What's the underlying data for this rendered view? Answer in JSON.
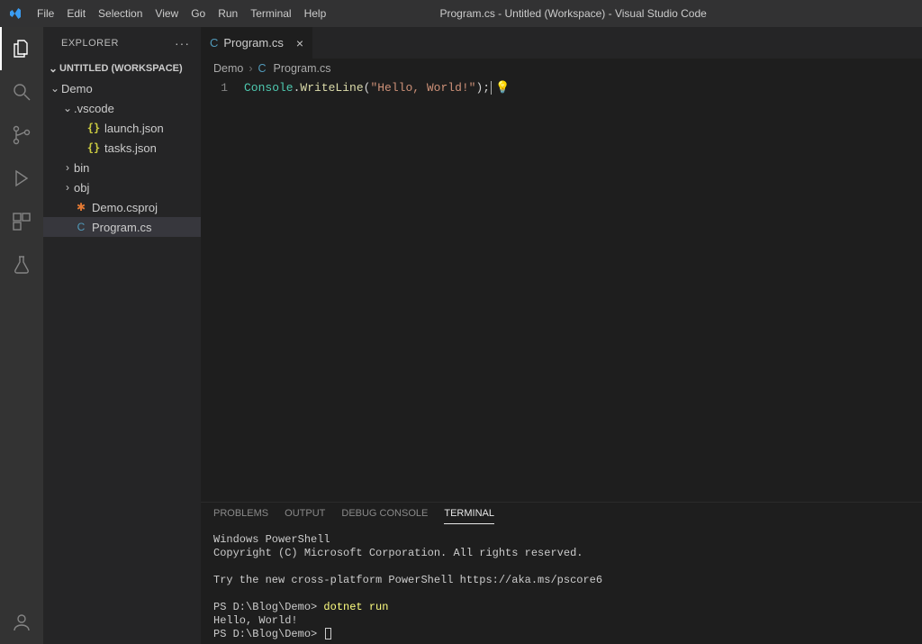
{
  "window": {
    "title": "Program.cs - Untitled (Workspace) - Visual Studio Code"
  },
  "menubar": [
    "File",
    "Edit",
    "Selection",
    "View",
    "Go",
    "Run",
    "Terminal",
    "Help"
  ],
  "sidebar": {
    "title": "EXPLORER",
    "section": "UNTITLED (WORKSPACE)",
    "tree": {
      "demo": "Demo",
      "vscode": ".vscode",
      "launch": "launch.json",
      "tasks": "tasks.json",
      "bin": "bin",
      "obj": "obj",
      "csproj": "Demo.csproj",
      "program": "Program.cs"
    }
  },
  "tab": {
    "label": "Program.cs"
  },
  "breadcrumbs": {
    "a": "Demo",
    "b": "Program.cs"
  },
  "editor": {
    "lineNumber": "1",
    "tok_type": "Console",
    "tok_dot": ".",
    "tok_member": "WriteLine",
    "tok_open": "(",
    "tok_string": "\"Hello, World!\"",
    "tok_close": ");"
  },
  "panel": {
    "tabs": {
      "problems": "PROBLEMS",
      "output": "OUTPUT",
      "debug": "DEBUG CONSOLE",
      "terminal": "TERMINAL"
    },
    "lines": {
      "l1": "Windows PowerShell",
      "l2": "Copyright (C) Microsoft Corporation. All rights reserved.",
      "l3": "Try the new cross-platform PowerShell https://aka.ms/pscore6",
      "prompt1": "PS D:\\Blog\\Demo> ",
      "cmd": "dotnet run",
      "l5": "Hello, World!",
      "prompt2": "PS D:\\Blog\\Demo> "
    }
  }
}
